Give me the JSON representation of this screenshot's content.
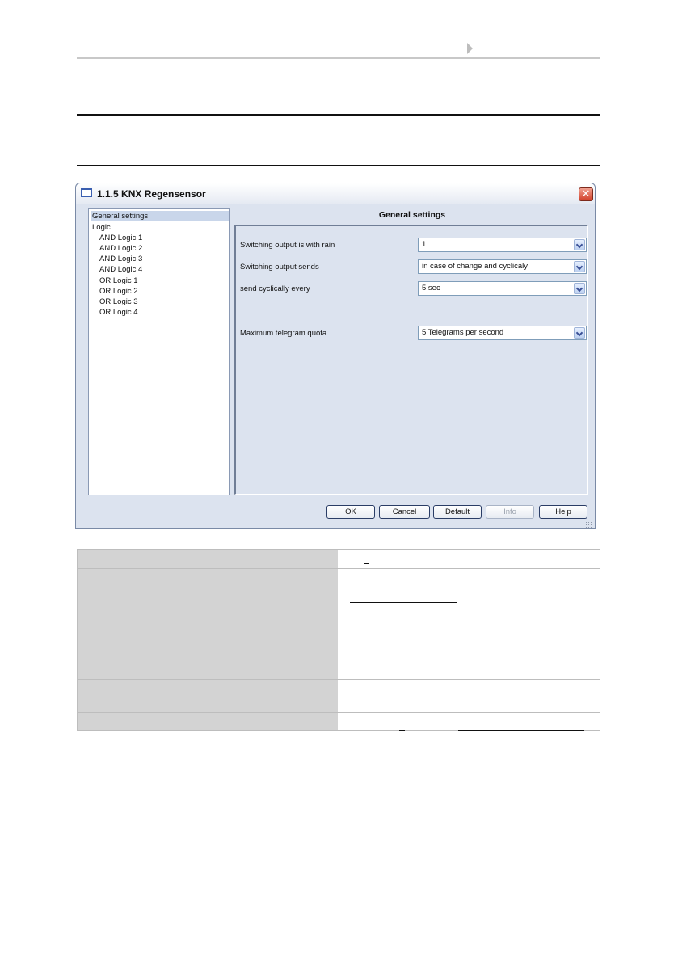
{
  "window": {
    "title": "1.1.5 KNX Regensensor",
    "close_glyph": "✕"
  },
  "tree": {
    "items": [
      {
        "label": "General settings",
        "selected": true,
        "indent": 0
      },
      {
        "label": "Logic",
        "indent": 0
      },
      {
        "label": "AND Logic 1",
        "indent": 1
      },
      {
        "label": "AND Logic 2",
        "indent": 1
      },
      {
        "label": "AND Logic 3",
        "indent": 1
      },
      {
        "label": "AND Logic 4",
        "indent": 1
      },
      {
        "label": "OR Logic 1",
        "indent": 1
      },
      {
        "label": "OR Logic 2",
        "indent": 1
      },
      {
        "label": "OR Logic 3",
        "indent": 1
      },
      {
        "label": "OR Logic 4",
        "indent": 1
      }
    ]
  },
  "panel": {
    "title": "General settings",
    "params": [
      {
        "label": "Switching output is with rain",
        "value": "1"
      },
      {
        "label": "Switching output sends",
        "value": "in case of change and cyclicaly"
      },
      {
        "label": "send cyclically every",
        "value": "5 sec"
      },
      {
        "label": "Maximum telegram quota",
        "value": "5 Telegrams per second"
      }
    ]
  },
  "buttons": {
    "ok": "OK",
    "cancel": "Cancel",
    "default": "Default",
    "info": "Info",
    "help": "Help"
  },
  "icons": [
    "window-icon",
    "close-icon",
    "dropdown-arrow-icon",
    "resize-grip-icon",
    "header-arrow-icon"
  ]
}
